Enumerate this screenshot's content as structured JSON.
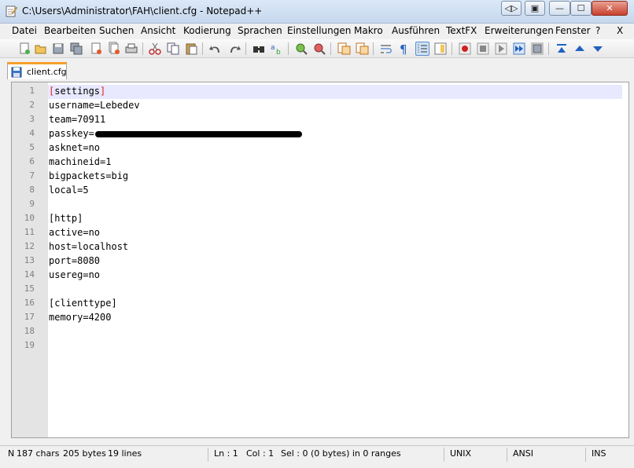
{
  "window": {
    "title": "C:\\Users\\Administrator\\FAH\\client.cfg - Notepad++",
    "buttons": {
      "extra": "◁▷",
      "restore_down": "▣",
      "minimize": "—",
      "maximize": "☐",
      "close": "✕"
    }
  },
  "menu": [
    "Datei",
    "Bearbeiten",
    "Suchen",
    "Ansicht",
    "Kodierung",
    "Sprachen",
    "Einstellungen",
    "Makro",
    "Ausführen",
    "TextFX",
    "Erweiterungen",
    "Fenster",
    "?",
    "X"
  ],
  "toolbar": {
    "icons": [
      "new-file-icon",
      "open-file-icon",
      "save-icon",
      "save-all-icon",
      "close-icon",
      "close-all-icon",
      "print-icon",
      "cut-icon",
      "copy-icon",
      "paste-icon",
      "undo-icon",
      "redo-icon",
      "find-icon",
      "replace-icon",
      "zoom-in-icon",
      "zoom-out-icon",
      "sync-v-icon",
      "sync-h-icon",
      "word-wrap-icon",
      "show-all-chars-icon",
      "indent-guide-icon",
      "doc-map-icon",
      "record-macro-icon",
      "stop-macro-icon",
      "play-macro-icon",
      "run-macro-multiple-icon",
      "save-macro-icon",
      "trim-icon",
      "up-icon",
      "down-icon"
    ]
  },
  "tab": {
    "label": "client.cfg"
  },
  "editor": {
    "lines": [
      {
        "num": "1",
        "text": "[settings]"
      },
      {
        "num": "2",
        "text": "username=Lebedev"
      },
      {
        "num": "3",
        "text": "team=70911"
      },
      {
        "num": "4",
        "text": "passkey="
      },
      {
        "num": "5",
        "text": "asknet=no"
      },
      {
        "num": "6",
        "text": "machineid=1"
      },
      {
        "num": "7",
        "text": "bigpackets=big"
      },
      {
        "num": "8",
        "text": "local=5"
      },
      {
        "num": "9",
        "text": ""
      },
      {
        "num": "10",
        "text": "[http]"
      },
      {
        "num": "11",
        "text": "active=no"
      },
      {
        "num": "12",
        "text": "host=localhost"
      },
      {
        "num": "13",
        "text": "port=8080"
      },
      {
        "num": "14",
        "text": "usereg=no"
      },
      {
        "num": "15",
        "text": ""
      },
      {
        "num": "16",
        "text": "[clienttype]"
      },
      {
        "num": "17",
        "text": "memory=4200"
      },
      {
        "num": "18",
        "text": ""
      },
      {
        "num": "19",
        "text": ""
      }
    ]
  },
  "status": {
    "type_char": "N",
    "chars": "187 chars",
    "bytes": "205 bytes",
    "lines": "19 lines",
    "ln": "Ln : 1",
    "col": "Col : 1",
    "sel": "Sel : 0 (0 bytes) in 0 ranges",
    "eol": "UNIX",
    "encoding": "ANSI",
    "mode": "INS"
  }
}
